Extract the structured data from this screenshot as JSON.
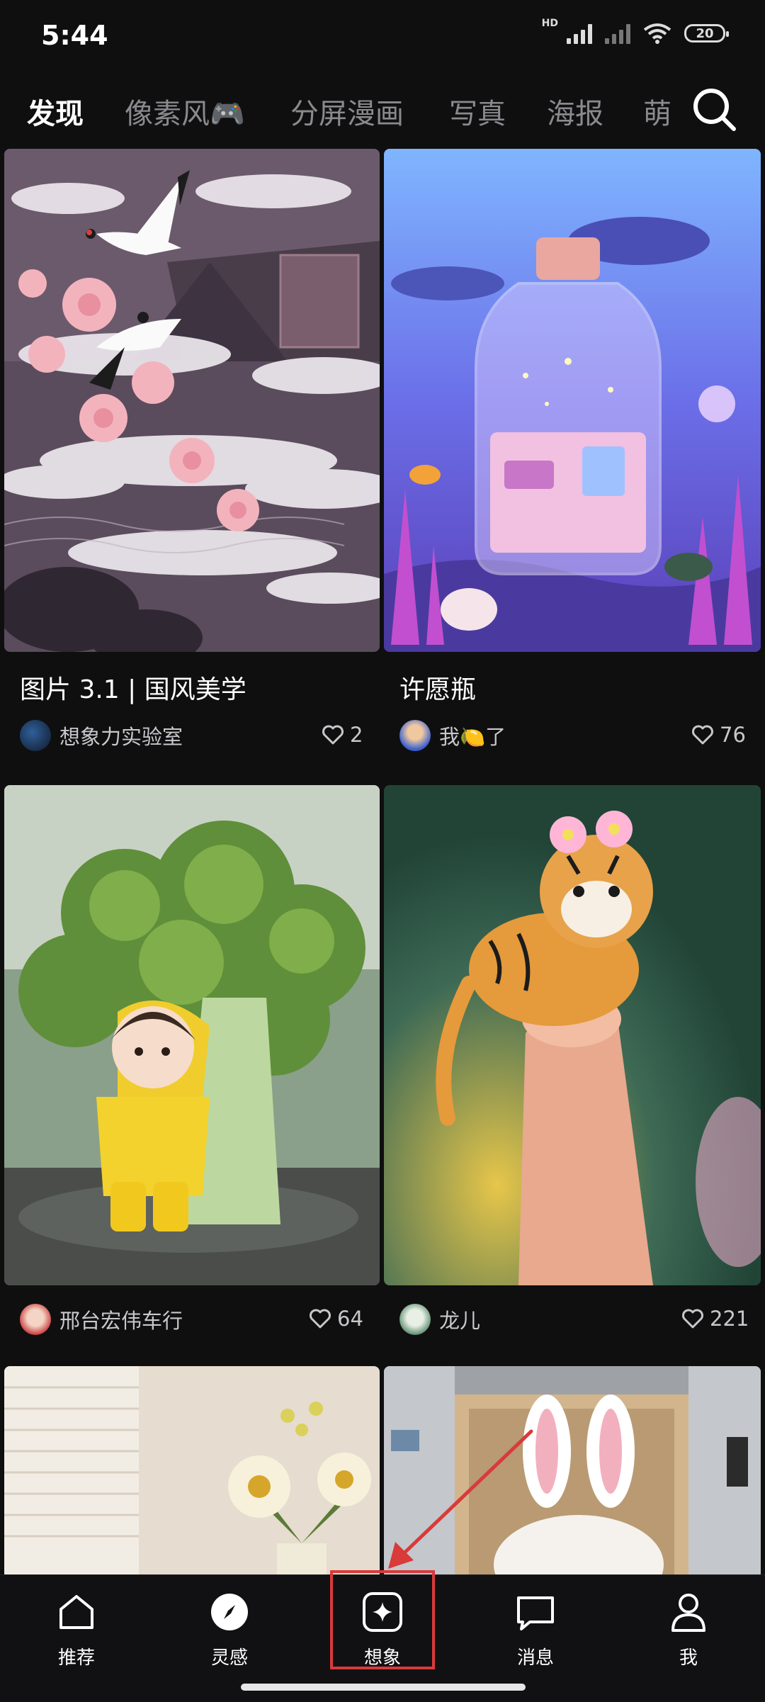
{
  "status_bar": {
    "time": "5:44",
    "hd": "HD",
    "battery": "20"
  },
  "tabs": [
    {
      "label": "发现",
      "active": true
    },
    {
      "label": "像素风🎮",
      "active": false
    },
    {
      "label": "分屏漫画",
      "active": false
    },
    {
      "label": "写真",
      "active": false
    },
    {
      "label": "海报",
      "active": false
    },
    {
      "label": "萌",
      "active": false
    }
  ],
  "feed": [
    {
      "title": "图片 3.1 | 国风美学",
      "author": "想象力实验室",
      "likes": "2",
      "image": "chinese-ink-birds-peonies"
    },
    {
      "title": "许愿瓶",
      "author": "我🍋了",
      "likes": "76",
      "image": "wishing-bottle-underwater"
    },
    {
      "title": "",
      "author": "邢台宏伟车行",
      "likes": "64",
      "image": "girl-raincoat-broccoli"
    },
    {
      "title": "",
      "author": "龙儿",
      "likes": "221",
      "image": "tiny-tiger-on-finger"
    },
    {
      "title": "",
      "author": "",
      "likes": "",
      "image": "flowers-in-vase"
    },
    {
      "title": "",
      "author": "",
      "likes": "",
      "image": "bunny-in-elevator"
    }
  ],
  "bottom_nav": [
    {
      "label": "推荐",
      "icon": "home-icon"
    },
    {
      "label": "灵感",
      "icon": "compass-icon"
    },
    {
      "label": "想象",
      "icon": "sparkle-icon"
    },
    {
      "label": "消息",
      "icon": "message-icon"
    },
    {
      "label": "我",
      "icon": "person-icon"
    }
  ],
  "colors": {
    "background": "#0f0f10",
    "annotation": "#d93a3a",
    "tab_inactive": "#8a8a8e"
  }
}
